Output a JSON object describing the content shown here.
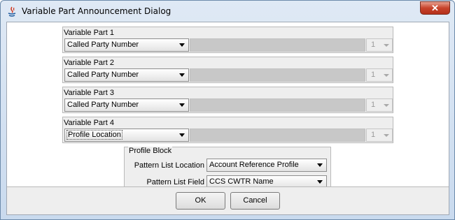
{
  "window": {
    "title": "Variable Part Announcement Dialog",
    "close_glyph": "✕"
  },
  "parts": [
    {
      "label": "Variable Part 1",
      "selected": "Called Party Number",
      "spinner": "1"
    },
    {
      "label": "Variable Part 2",
      "selected": "Called Party Number",
      "spinner": "1"
    },
    {
      "label": "Variable Part 3",
      "selected": "Called Party Number",
      "spinner": "1"
    },
    {
      "label": "Variable Part 4",
      "selected": "Profile Location",
      "spinner": "1"
    }
  ],
  "profile_block": {
    "title": "Profile Block",
    "pattern_list_location_label": "Pattern List Location",
    "pattern_list_location_value": "Account Reference Profile",
    "pattern_list_field_label": "Pattern List Field",
    "pattern_list_field_value": "CCS CWTR Name"
  },
  "buttons": {
    "ok": "OK",
    "cancel": "Cancel"
  },
  "icons": {
    "app": "java-app-icon",
    "close": "close-icon",
    "dropdown": "chevron-down-icon"
  },
  "colors": {
    "disabled_field": "#c8c8c8",
    "close_button": "#c7432b"
  }
}
